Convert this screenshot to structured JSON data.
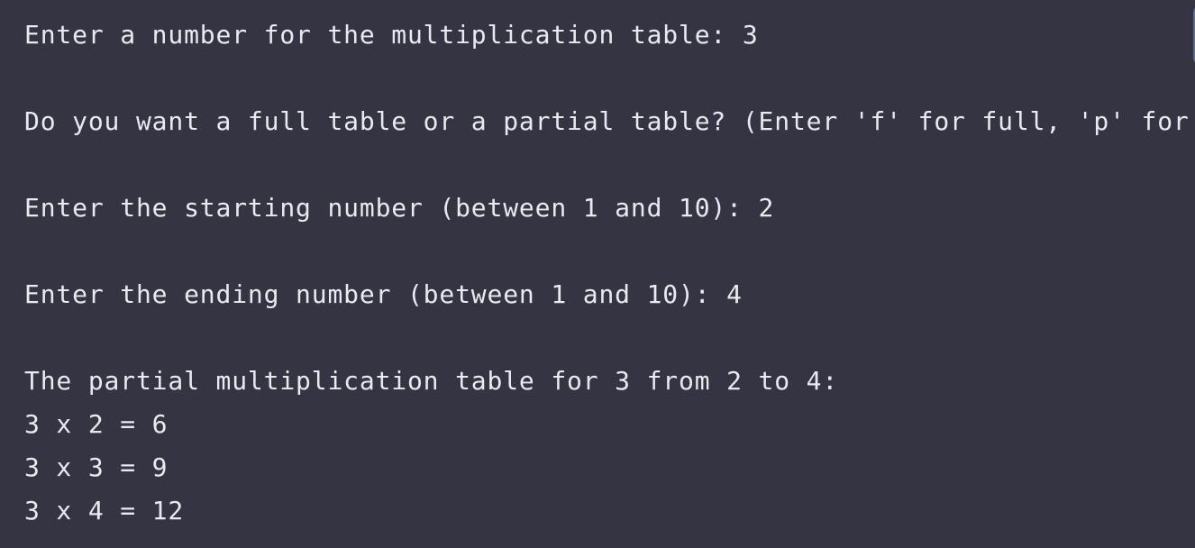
{
  "terminal": {
    "lines": [
      "Enter a number for the multiplication table: 3",
      "Do you want a full table or a partial table? (Enter 'f' for full, 'p' for par",
      "Enter the starting number (between 1 and 10): 2",
      "Enter the ending number (between 1 and 10): 4",
      "The partial multiplication table for 3 from 2 to 4:",
      "3 x 2 = 6",
      "3 x 3 = 9",
      "3 x 4 = 12"
    ]
  }
}
